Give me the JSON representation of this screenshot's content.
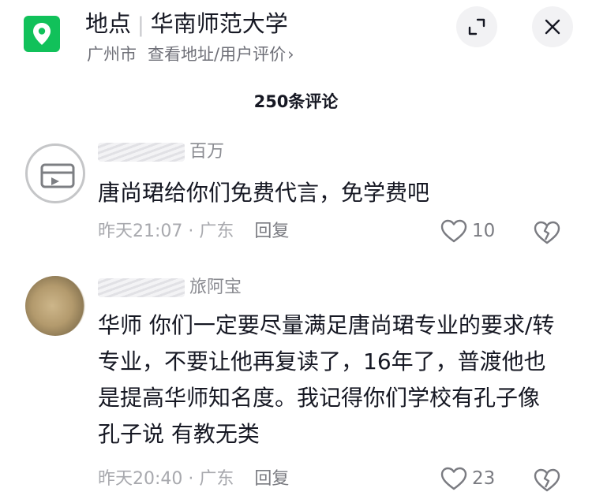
{
  "header": {
    "title_prefix": "地点",
    "title_name": "华南师范大学",
    "city": "广州市",
    "subtitle_link": "查看地址/用户评价",
    "chevron": "›"
  },
  "comment_count": "250条评论",
  "comments": [
    {
      "username_visible": "百万",
      "text": "唐尚珺给你们免费代言，免学费吧",
      "time": "昨天21:07",
      "region": "广东",
      "reply_label": "回复",
      "likes": "10"
    },
    {
      "username_visible": "旅阿宝",
      "text": "华师 你们一定要尽量满足唐尚珺专业的要求/转专业，不要让他再复读了，16年了，普渡他也是提高华师知名度。我记得你们学校有孔子像 孔子说 有教无类",
      "time": "昨天20:40",
      "region": "广东",
      "reply_label": "回复",
      "likes": "23"
    }
  ],
  "icons": {
    "location": "location-pin-icon",
    "expand": "expand-icon",
    "close": "close-icon",
    "like": "heart-outline-icon",
    "dislike": "broken-heart-icon"
  },
  "colors": {
    "accent": "#11c15a",
    "text": "#161823",
    "muted": "#a8a9ae"
  }
}
